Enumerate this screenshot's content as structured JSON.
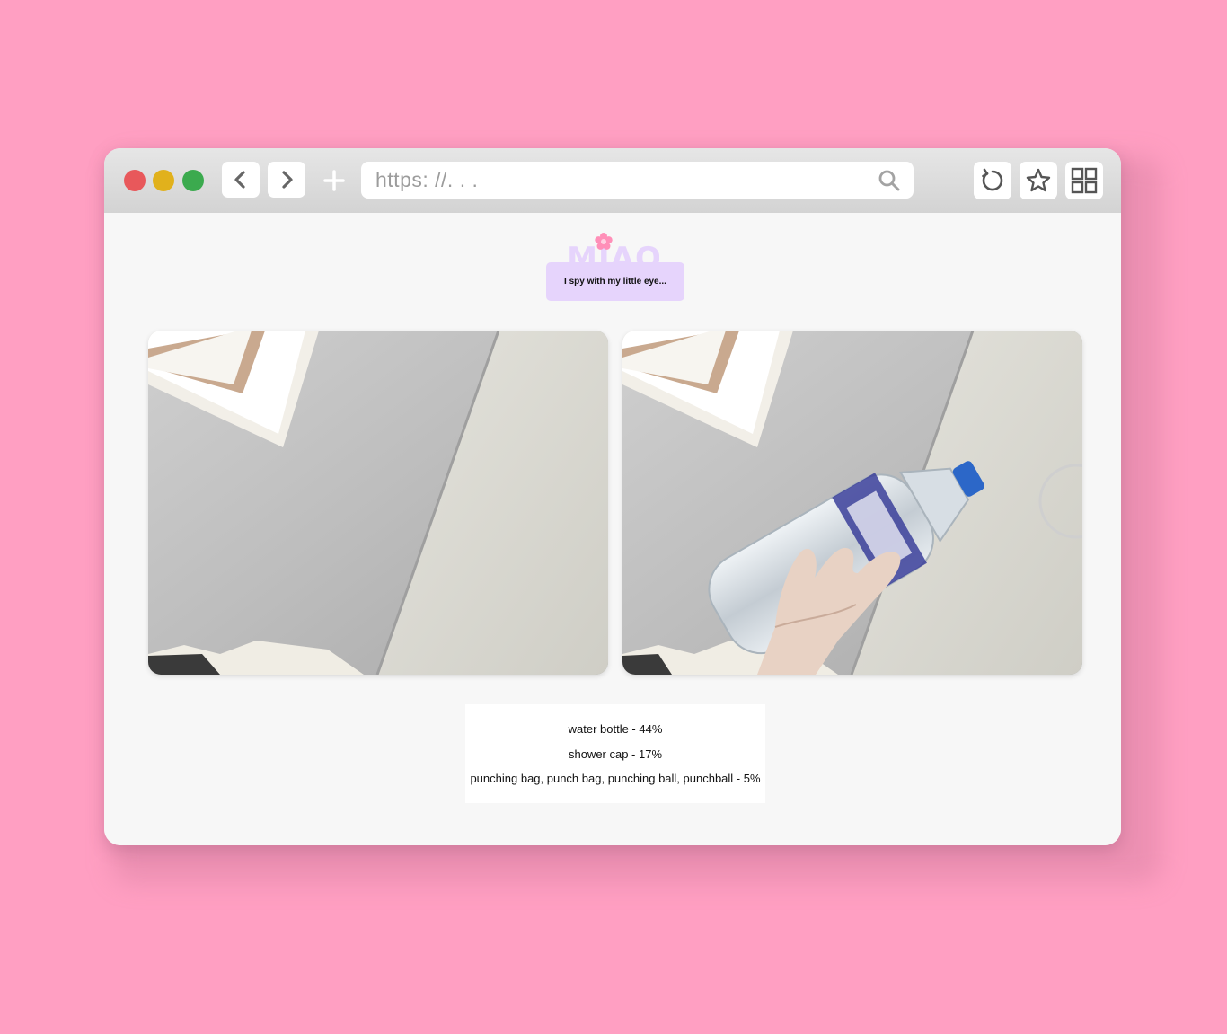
{
  "browser": {
    "url_placeholder": "https: //. . .",
    "window_controls": [
      "close",
      "minimize",
      "maximize"
    ],
    "nav_icons": [
      "chevron-left-icon",
      "chevron-right-icon",
      "plus-icon"
    ],
    "tool_icons": [
      "reload-icon",
      "star-icon",
      "grid-icon"
    ]
  },
  "app": {
    "logo_text": "MIAO",
    "prompt": "I spy with my little eye..."
  },
  "images": [
    {
      "name": "webcam-snapshot-empty"
    },
    {
      "name": "webcam-snapshot-water-bottle"
    }
  ],
  "predictions": [
    {
      "text": "water bottle - 44%"
    },
    {
      "text": "shower cap - 17%"
    },
    {
      "text": "punching bag, punch bag, punching ball, punchball - 5%"
    }
  ],
  "colors": {
    "background": "#ff9fc2",
    "prompt_box": "#e6d4fc",
    "logo": "#e6d4fc",
    "logo_flower": "#ff8fb8",
    "close": "#e8585b",
    "minimize": "#e1b11c",
    "maximize": "#3baa4e"
  }
}
